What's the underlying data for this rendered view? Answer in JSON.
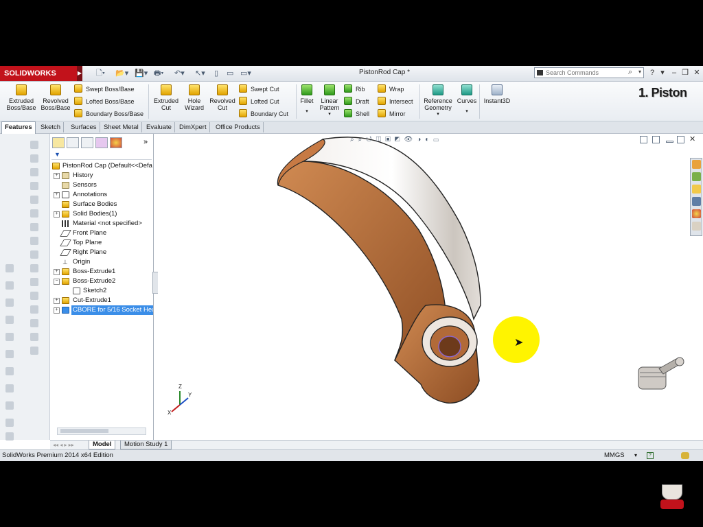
{
  "titlebar": {
    "logo": "SOLIDWORKS",
    "document_title": "PistonRod Cap *",
    "search_placeholder": "Search Commands"
  },
  "ribbon": {
    "big_buttons": [
      {
        "label": "Extruded\nBoss/Base",
        "icon": "extruded-boss-icon"
      },
      {
        "label": "Revolved\nBoss/Base",
        "icon": "revolved-boss-icon"
      },
      {
        "label": "Extruded\nCut",
        "icon": "extruded-cut-icon"
      },
      {
        "label": "Hole\nWizard",
        "icon": "hole-wizard-icon"
      },
      {
        "label": "Revolved\nCut",
        "icon": "revolved-cut-icon"
      },
      {
        "label": "Fillet",
        "icon": "fillet-icon"
      },
      {
        "label": "Linear\nPattern",
        "icon": "linear-pattern-icon"
      },
      {
        "label": "Reference\nGeometry",
        "icon": "reference-geometry-icon"
      },
      {
        "label": "Curves",
        "icon": "curves-icon"
      },
      {
        "label": "Instant3D",
        "icon": "instant3d-icon"
      }
    ],
    "small_buttons": {
      "swept_boss": "Swept Boss/Base",
      "lofted_boss": "Lofted Boss/Base",
      "boundary_boss": "Boundary Boss/Base",
      "swept_cut": "Swept Cut",
      "lofted_cut": "Lofted Cut",
      "boundary_cut": "Boundary Cut",
      "rib": "Rib",
      "draft": "Draft",
      "shell": "Shell",
      "wrap": "Wrap",
      "intersect": "Intersect",
      "mirror": "Mirror"
    },
    "overlay_label": "1. Piston"
  },
  "tabs": [
    "Features",
    "Sketch",
    "Surfaces",
    "Sheet Metal",
    "Evaluate",
    "DimXpert",
    "Office Products"
  ],
  "feature_tree": {
    "root": "PistonRod Cap  (Default<<Defa",
    "items": [
      {
        "label": "History",
        "expandable": true
      },
      {
        "label": "Sensors",
        "expandable": false
      },
      {
        "label": "Annotations",
        "expandable": true
      },
      {
        "label": "Surface Bodies",
        "expandable": false
      },
      {
        "label": "Solid Bodies(1)",
        "expandable": true
      },
      {
        "label": "Material <not specified>",
        "expandable": false
      },
      {
        "label": "Front Plane",
        "expandable": false
      },
      {
        "label": "Top Plane",
        "expandable": false
      },
      {
        "label": "Right Plane",
        "expandable": false
      },
      {
        "label": "Origin",
        "expandable": false
      },
      {
        "label": "Boss-Extrude1",
        "expandable": true
      },
      {
        "label": "Boss-Extrude2",
        "expandable": true
      },
      {
        "label": "Sketch2",
        "expandable": false
      },
      {
        "label": "Cut-Extrude1",
        "expandable": true
      },
      {
        "label": "CBORE for 5/16 Socket Hea",
        "expandable": true
      }
    ]
  },
  "bottom_tabs": [
    "Model",
    "Motion Study 1"
  ],
  "status": {
    "edition": "SolidWorks Premium 2014 x64 Edition",
    "units": "MMGS"
  },
  "colors": {
    "brand_red": "#c2121b",
    "selection_blue": "#3b8ee8",
    "part_copper": "#b86a3a",
    "highlight_yellow": "#fff400"
  }
}
